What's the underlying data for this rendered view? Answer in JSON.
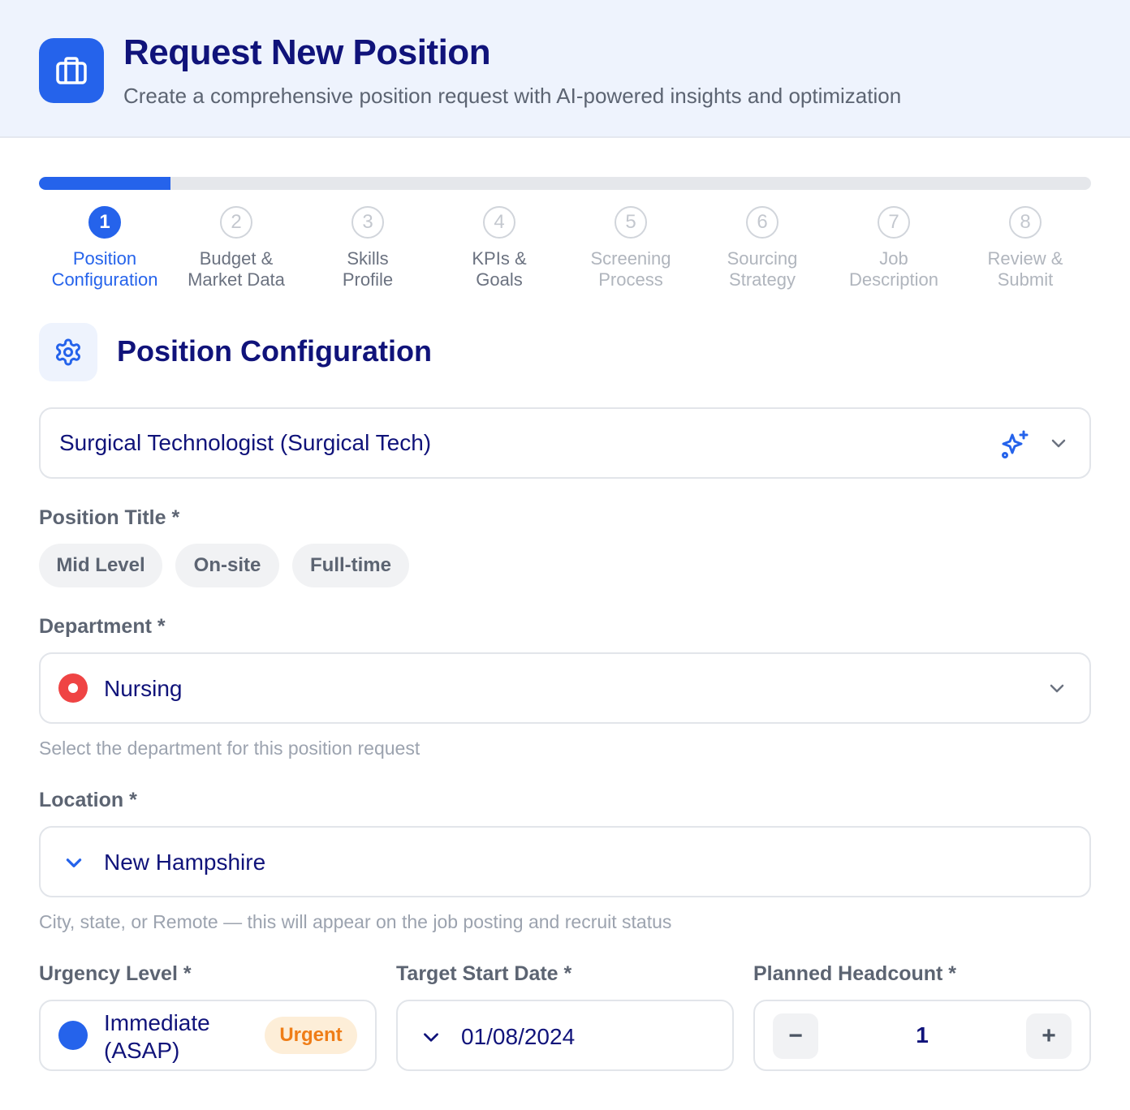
{
  "header": {
    "title": "Request New Position",
    "subtitle": "Create a comprehensive position request with AI-powered insights and optimization",
    "icon": "briefcase-icon"
  },
  "progress": {
    "fraction": 0.125
  },
  "steps": [
    {
      "number": "1",
      "line1": "Position",
      "line2": "Configuration",
      "state": "active"
    },
    {
      "number": "2",
      "line1": "Budget &",
      "line2": "Market Data",
      "state": "pending"
    },
    {
      "number": "3",
      "line1": "Skills",
      "line2": "Profile",
      "state": "pending"
    },
    {
      "number": "4",
      "line1": "KPIs &",
      "line2": "Goals",
      "state": "pending"
    },
    {
      "number": "5",
      "line1": "Screening",
      "line2": "Process",
      "state": "pending"
    },
    {
      "number": "6",
      "line1": "Sourcing",
      "line2": "Strategy",
      "state": "pending"
    },
    {
      "number": "7",
      "line1": "Job",
      "line2": "Description",
      "state": "pending"
    },
    {
      "number": "8",
      "line1": "Review &",
      "line2": "Submit",
      "state": "pending"
    }
  ],
  "section": {
    "title": "Position Configuration",
    "icon": "gear-icon"
  },
  "position_select": {
    "value": "Surgical Technologist (Surgical Tech)"
  },
  "position_title": {
    "label": "Position Title *",
    "chips": [
      "Mid Level",
      "On-site",
      "Full-time"
    ]
  },
  "department": {
    "label": "Department *",
    "value": "Nursing",
    "hint": "Select the department for this position request",
    "dot_color": "#ef4444"
  },
  "location": {
    "label": "Location *",
    "value": "New Hampshire",
    "hint": "City, state, or Remote — this will appear on the job posting and recruit status"
  },
  "urgency": {
    "label": "Urgency Level *",
    "value_line1": "Immediate",
    "value_line2": "(ASAP)",
    "badge": "Urgent",
    "dot_color": "#2563eb"
  },
  "start_date": {
    "label": "Target Start Date *",
    "value": "01/08/2024"
  },
  "headcount": {
    "label": "Planned Headcount *",
    "value": "1",
    "minus": "−",
    "plus": "+"
  },
  "colors": {
    "accent": "#2563eb",
    "title": "#10137a",
    "badge_text": "#ef7d17",
    "badge_bg": "#fdeed8"
  }
}
